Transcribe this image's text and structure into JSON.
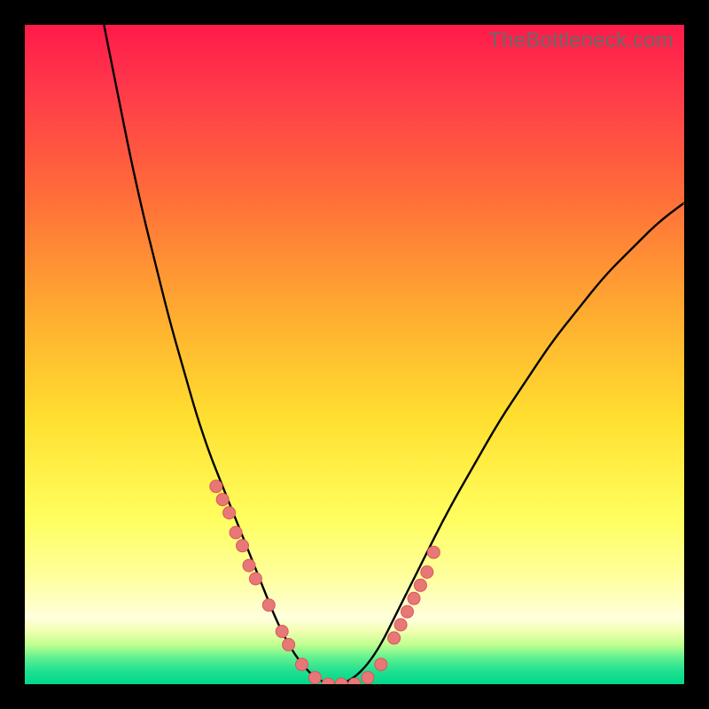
{
  "watermark": "TheBottleneck.com",
  "colors": {
    "frame": "#000000",
    "curve": "#000000",
    "marker_fill": "#e87878",
    "marker_stroke": "#d85858"
  },
  "chart_data": {
    "type": "line",
    "title": "",
    "xlabel": "",
    "ylabel": "",
    "xlim": [
      0,
      100
    ],
    "ylim": [
      0,
      100
    ],
    "series": [
      {
        "name": "left-curve",
        "x": [
          12,
          14,
          16,
          18,
          20,
          22,
          24,
          26,
          28,
          30,
          32,
          34,
          36,
          38,
          40,
          42,
          44,
          46
        ],
        "values": [
          100,
          90,
          80,
          71,
          63,
          55,
          48,
          41,
          35,
          30,
          25,
          20,
          15,
          10,
          6,
          3,
          1,
          0
        ]
      },
      {
        "name": "right-curve",
        "x": [
          46,
          48,
          50,
          52,
          54,
          56,
          58,
          60,
          64,
          68,
          72,
          76,
          80,
          84,
          88,
          92,
          96,
          100
        ],
        "values": [
          0,
          0,
          1,
          3,
          6,
          10,
          14,
          18,
          26,
          33,
          40,
          46,
          52,
          57,
          62,
          66,
          70,
          73
        ]
      },
      {
        "name": "markers",
        "x": [
          29,
          30,
          31,
          32,
          33,
          34,
          35,
          37,
          39,
          40,
          42,
          44,
          46,
          48,
          50,
          52,
          54,
          56,
          57,
          58,
          59,
          60,
          61,
          62
        ],
        "values": [
          30,
          28,
          26,
          23,
          21,
          18,
          16,
          12,
          8,
          6,
          3,
          1,
          0,
          0,
          0,
          1,
          3,
          7,
          9,
          11,
          13,
          15,
          17,
          20
        ]
      }
    ]
  }
}
